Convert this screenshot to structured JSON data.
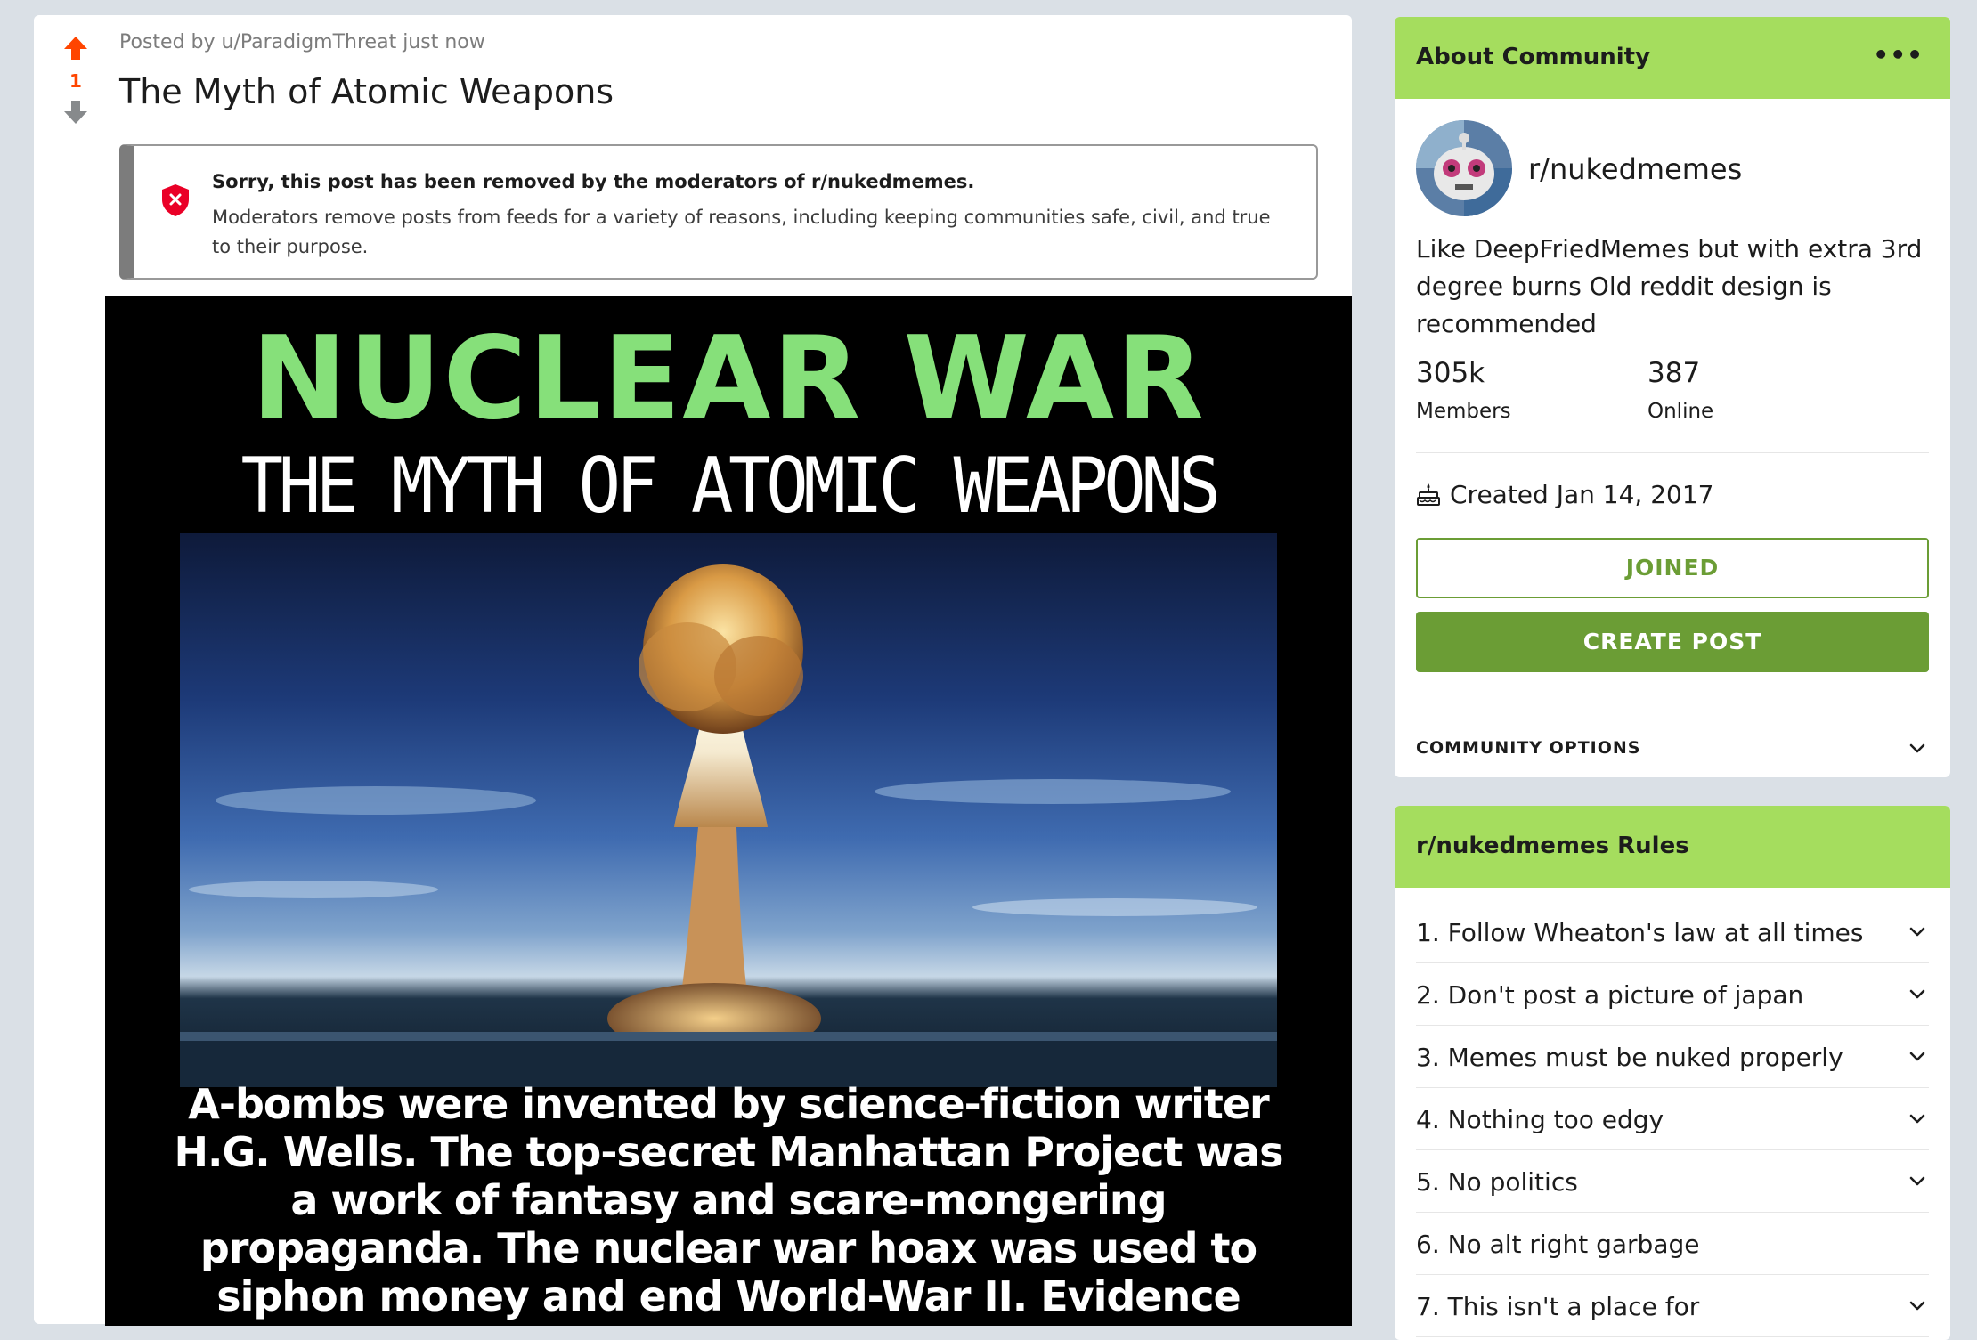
{
  "post": {
    "vote_count": "1",
    "meta": "Posted by u/ParadigmThreat just now",
    "title": "The Myth of Atomic Weapons",
    "removed_notice": {
      "title": "Sorry, this post has been removed by the moderators of r/nukedmemes.",
      "body": "Moderators remove posts from feeds for a variety of reasons, including keeping communities safe, civil, and true to their purpose."
    },
    "image": {
      "headline": "NUCLEAR WAR",
      "subheadline": "THE MYTH OF ATOMIC WEAPONS",
      "body": "A-bombs were invented by science-fiction writer H.G. Wells. The top-secret Manhattan Project was a work of fantasy and scare-mongering propaganda. The nuclear war hoax was used to siphon money and end World-War II. Evidence proves that the US dropped napalm carpet/fire-"
    }
  },
  "about": {
    "header": "About Community",
    "more": "•••",
    "name": "r/nukedmemes",
    "description": "Like DeepFriedMemes but with extra 3rd degree burns Old reddit design is recommended",
    "members_value": "305k",
    "members_label": "Members",
    "online_value": "387",
    "online_label": "Online",
    "created": "Created Jan 14, 2017",
    "joined_button": "JOINED",
    "create_post_button": "CREATE POST",
    "options_label": "COMMUNITY OPTIONS"
  },
  "rules": {
    "header": "r/nukedmemes Rules",
    "items": [
      {
        "label": "1. Follow Wheaton's law at all times",
        "expandable": true
      },
      {
        "label": "2. Don't post a picture of japan",
        "expandable": true
      },
      {
        "label": "3. Memes must be nuked properly",
        "expandable": true
      },
      {
        "label": "4. Nothing too edgy",
        "expandable": true
      },
      {
        "label": "5. No politics",
        "expandable": true
      },
      {
        "label": "6. No alt right garbage",
        "expandable": false
      },
      {
        "label": "7. This isn't a place for",
        "expandable": true
      }
    ]
  },
  "colors": {
    "upvote": "#ff4500",
    "accent_green": "#a5dd5e",
    "button_green": "#6b9d35",
    "meme_headline": "#86e07a"
  },
  "icons": [
    "upvote-icon",
    "downvote-icon",
    "shield-x-icon",
    "cake-icon",
    "chevron-down-icon",
    "more-icon"
  ]
}
